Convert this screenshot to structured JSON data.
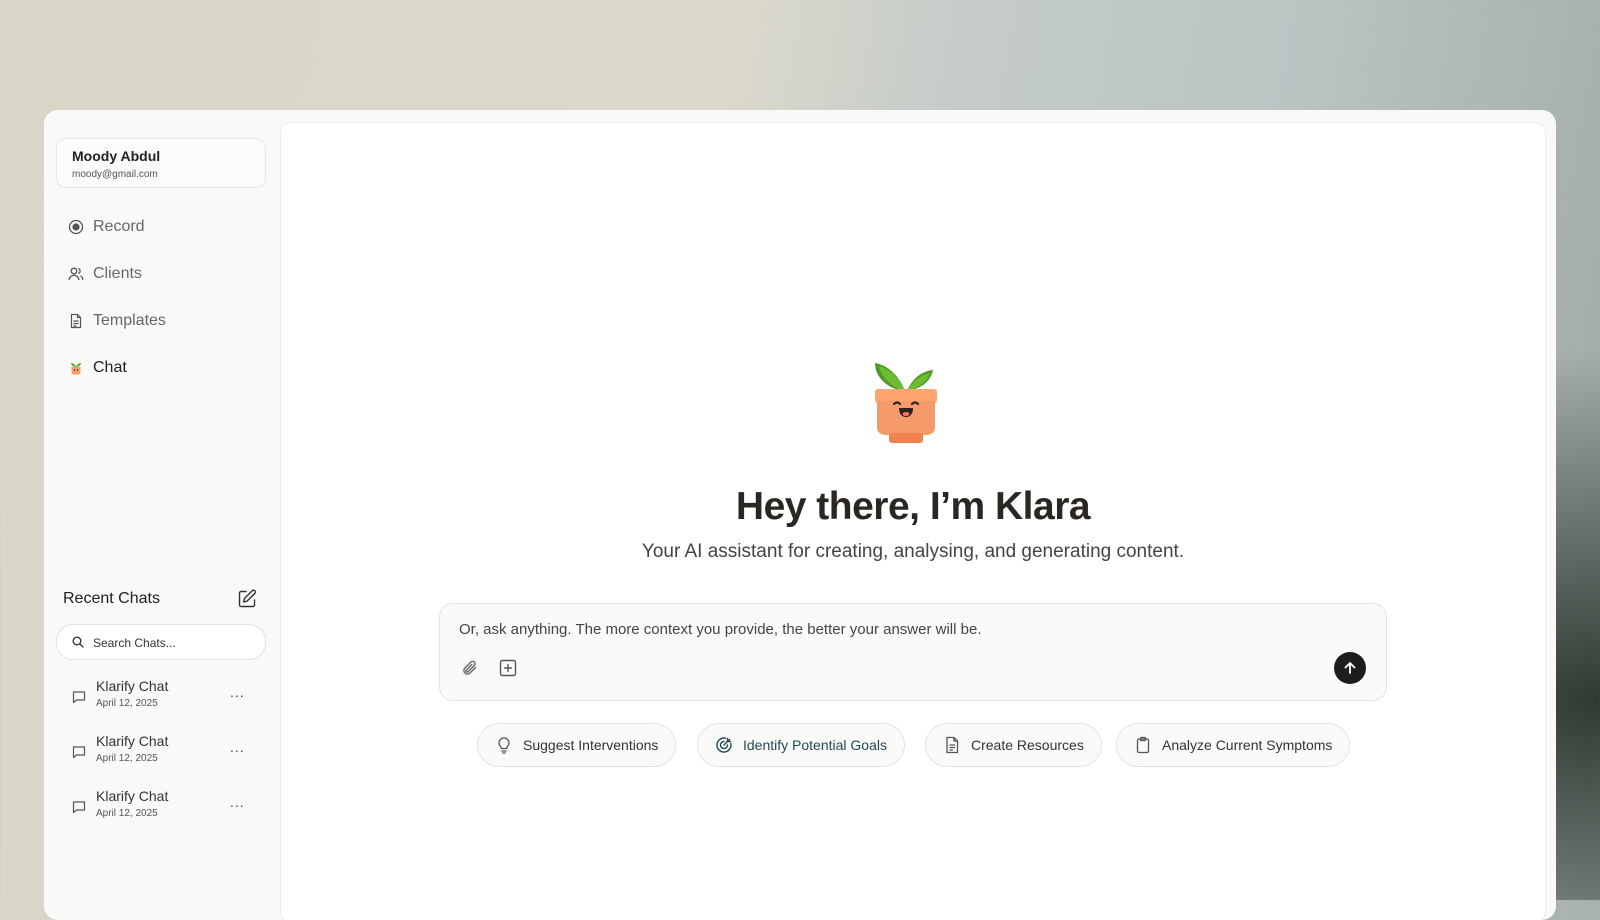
{
  "user": {
    "name": "Moody Abdul",
    "email": "moody@gmail.com"
  },
  "nav": [
    {
      "label": "Record",
      "icon": "record-icon"
    },
    {
      "label": "Clients",
      "icon": "users-icon"
    },
    {
      "label": "Templates",
      "icon": "document-icon"
    },
    {
      "label": "Chat",
      "icon": "plant-mascot-icon",
      "active": true
    }
  ],
  "recent": {
    "title": "Recent Chats",
    "search_placeholder": "Search Chats...",
    "items": [
      {
        "title": "Klarify Chat",
        "date": "April 12, 2025"
      },
      {
        "title": "Klarify Chat",
        "date": "April 12, 2025"
      },
      {
        "title": "Klarify Chat",
        "date": "April 12, 2025"
      }
    ],
    "more_label": "..."
  },
  "main": {
    "headline": "Hey there, I’m Klara",
    "subline": "Your AI assistant for creating, analysing, and generating content.",
    "composer_placeholder": "Or, ask anything. The more context you provide, the better your answer will be."
  },
  "suggestions": [
    {
      "label": "Suggest Interventions",
      "icon": "lightbulb-icon"
    },
    {
      "label": "Identify Potential Goals",
      "icon": "target-icon",
      "active": true
    },
    {
      "label": "Create Resources",
      "icon": "document-icon"
    },
    {
      "label": "Analyze Current Symptoms",
      "icon": "clipboard-icon"
    }
  ],
  "colors": {
    "send_button": "#1d1d1d",
    "mascot_pot": "#f59a6a",
    "mascot_leaf": "#5ea82f",
    "active_chip_text": "#1f4a54"
  }
}
